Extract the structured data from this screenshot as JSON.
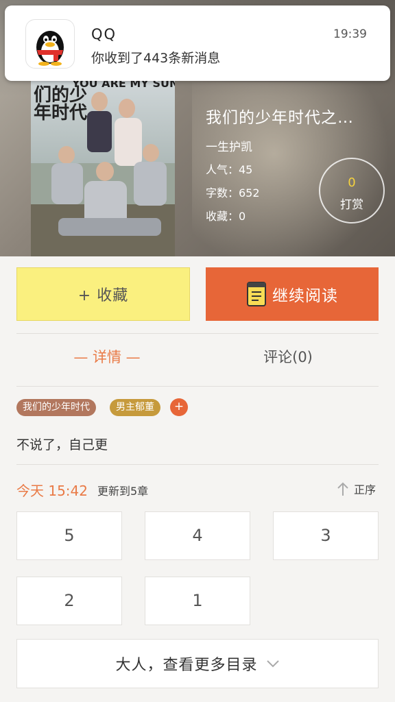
{
  "notification": {
    "app": "QQ",
    "time": "19:39",
    "message": "你收到了443条新消息",
    "icon": "qq-penguin-icon"
  },
  "cover": {
    "title_text": "们的少年时代",
    "top_text": "YOU ARE MY SUNSH"
  },
  "book": {
    "title": "我们的少年时代之…",
    "author": "一生护凯",
    "popularity": "人气：45",
    "word_count": "字数：652",
    "favorites": "收藏：0"
  },
  "tip": {
    "count": "0",
    "label": "打赏"
  },
  "actions": {
    "collect_label": "+ 收藏",
    "read_label": "继续阅读",
    "read_icon": "book-icon"
  },
  "tabs": {
    "detail": "— 详情 —",
    "comments": "评论(0)"
  },
  "tags": [
    "我们的少年时代",
    "男主郁董"
  ],
  "tag_add": "+",
  "description": "不说了，自己更",
  "update": {
    "date": "今天 15:42",
    "text": "更新到5章",
    "sort_label": "正序"
  },
  "chapters": [
    "5",
    "4",
    "3",
    "2",
    "1"
  ],
  "more_label": "大人，查看更多目录",
  "colors": {
    "accent": "#e76638",
    "collect_bg": "#faf07f",
    "tip_count": "#f6d33e"
  }
}
